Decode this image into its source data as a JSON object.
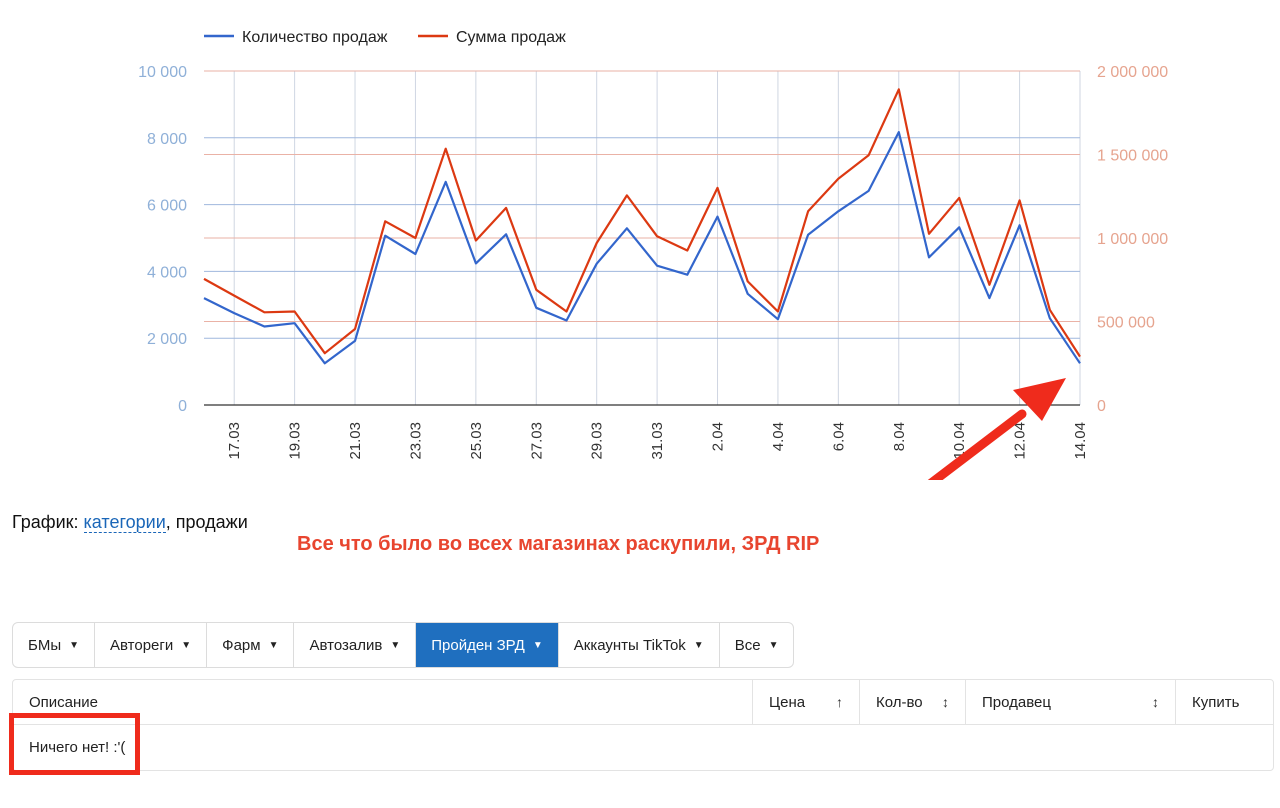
{
  "chart_data": {
    "type": "line",
    "x": [
      "16.03",
      "17.03",
      "18.03",
      "19.03",
      "20.03",
      "21.03",
      "22.03",
      "23.03",
      "24.03",
      "25.03",
      "26.03",
      "27.03",
      "28.03",
      "29.03",
      "30.03",
      "31.03",
      "1.04",
      "2.04",
      "3.04",
      "4.04",
      "5.04",
      "6.04",
      "7.04",
      "8.04",
      "9.04",
      "10.04",
      "11.04",
      "12.04",
      "13.04",
      "14.04"
    ],
    "x_tick_labels": [
      "17.03",
      "19.03",
      "21.03",
      "23.03",
      "25.03",
      "27.03",
      "29.03",
      "31.03",
      "2.04",
      "4.04",
      "6.04",
      "8.04",
      "10.04",
      "12.04",
      "14.04"
    ],
    "series": [
      {
        "name": "Количество продаж",
        "axis": "left",
        "color": "#3366cc",
        "values": [
          3200,
          2750,
          2350,
          2450,
          1250,
          1920,
          5070,
          4520,
          6680,
          4240,
          5110,
          2910,
          2530,
          4230,
          5290,
          4170,
          3900,
          5640,
          3330,
          2570,
          5100,
          5800,
          6410,
          8170,
          4420,
          5320,
          3200,
          5380,
          2600,
          1250
        ]
      },
      {
        "name": "Сумма продаж",
        "axis": "right",
        "color": "#dc3912",
        "values": [
          755000,
          655000,
          555000,
          560000,
          310000,
          455000,
          1100000,
          1000000,
          1535000,
          985000,
          1180000,
          690000,
          560000,
          970000,
          1255000,
          1010000,
          925000,
          1300000,
          740000,
          560000,
          1160000,
          1355000,
          1495000,
          1890000,
          1025000,
          1240000,
          720000,
          1225000,
          570000,
          290000
        ]
      }
    ],
    "y_left": {
      "min": 0,
      "max": 10000,
      "ticks": [
        "0",
        "2 000",
        "4 000",
        "6 000",
        "8 000",
        "10 000"
      ]
    },
    "y_right": {
      "min": 0,
      "max": 2000000,
      "ticks": [
        "0",
        "500 000",
        "1 000 000",
        "1 500 000",
        "2 000 000"
      ]
    },
    "legend": "top-left",
    "grid": true
  },
  "caption": {
    "prefix": "График:",
    "link": "категории",
    "suffix": ", продажи"
  },
  "annotation": "Все что было во всех магазинах раскупили, ЗРД RIP",
  "tabs": [
    {
      "label": "БМы",
      "active": false
    },
    {
      "label": "Автореги",
      "active": false
    },
    {
      "label": "Фарм",
      "active": false
    },
    {
      "label": "Автозалив",
      "active": false
    },
    {
      "label": "Пройден ЗРД",
      "active": true
    },
    {
      "label": "Аккаунты TikTok",
      "active": false
    },
    {
      "label": "Все",
      "active": false
    }
  ],
  "tab_caret": "▼",
  "table": {
    "columns": [
      {
        "label": "Описание",
        "sort": ""
      },
      {
        "label": "Цена",
        "sort": "↑"
      },
      {
        "label": "Кол-во",
        "sort": "↕"
      },
      {
        "label": "Продавец",
        "sort": "↕"
      },
      {
        "label": "Купить",
        "sort": ""
      }
    ],
    "empty_text": "Ничего нет! :'("
  },
  "colors": {
    "accent": "#1f6fbf",
    "annotation": "#e8452f",
    "highlight": "#ef2b1c"
  }
}
